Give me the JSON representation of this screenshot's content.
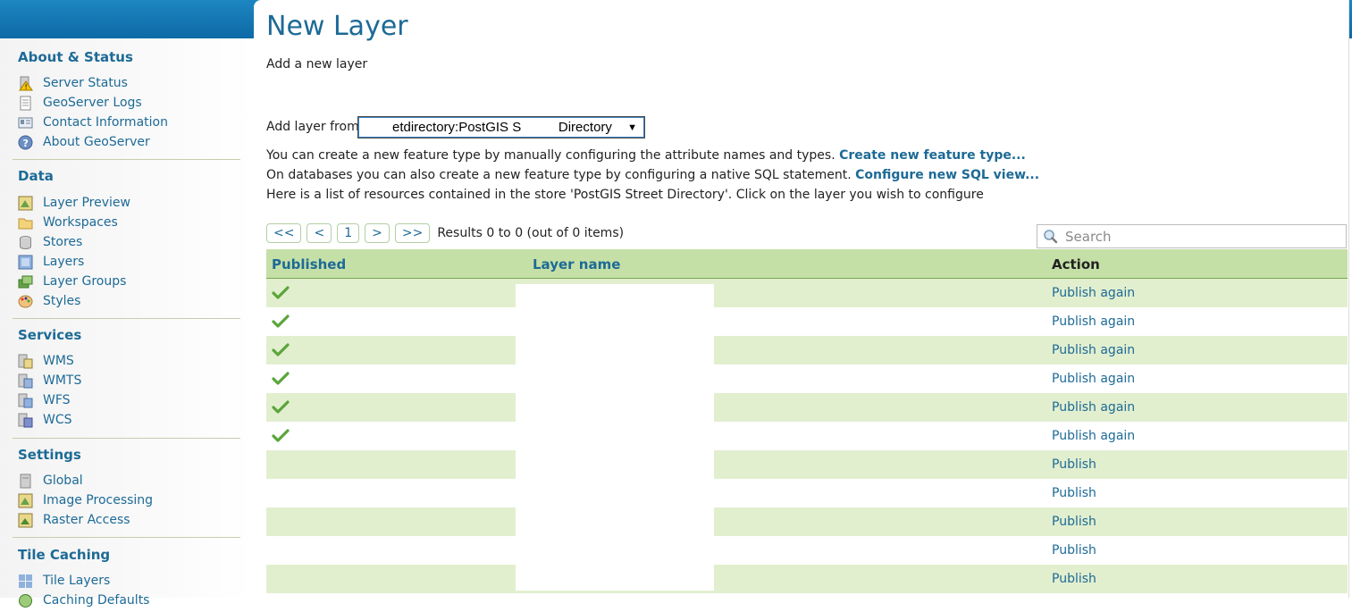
{
  "header": {
    "color": "#1479b8"
  },
  "sidebar": {
    "sections": [
      {
        "title": "About & Status",
        "items": [
          {
            "label": "Server Status",
            "icon": "server-status-icon"
          },
          {
            "label": "GeoServer Logs",
            "icon": "logs-icon"
          },
          {
            "label": "Contact Information",
            "icon": "contact-icon"
          },
          {
            "label": "About GeoServer",
            "icon": "about-icon"
          }
        ]
      },
      {
        "title": "Data",
        "items": [
          {
            "label": "Layer Preview",
            "icon": "layer-preview-icon"
          },
          {
            "label": "Workspaces",
            "icon": "folder-icon"
          },
          {
            "label": "Stores",
            "icon": "database-icon"
          },
          {
            "label": "Layers",
            "icon": "layers-icon"
          },
          {
            "label": "Layer Groups",
            "icon": "layer-groups-icon"
          },
          {
            "label": "Styles",
            "icon": "palette-icon"
          }
        ]
      },
      {
        "title": "Services",
        "items": [
          {
            "label": "WMS",
            "icon": "wms-icon"
          },
          {
            "label": "WMTS",
            "icon": "wmts-icon"
          },
          {
            "label": "WFS",
            "icon": "wfs-icon"
          },
          {
            "label": "WCS",
            "icon": "wcs-icon"
          }
        ]
      },
      {
        "title": "Settings",
        "items": [
          {
            "label": "Global",
            "icon": "global-icon"
          },
          {
            "label": "Image Processing",
            "icon": "image-processing-icon"
          },
          {
            "label": "Raster Access",
            "icon": "raster-access-icon"
          }
        ]
      },
      {
        "title": "Tile Caching",
        "items": [
          {
            "label": "Tile Layers",
            "icon": "tile-layers-icon"
          },
          {
            "label": "Caching Defaults",
            "icon": "caching-defaults-icon"
          }
        ]
      }
    ]
  },
  "main": {
    "title": "New Layer",
    "description": "Add a new layer",
    "add_from_label": "Add layer from",
    "store_select_value": "etdirectory:PostGIS S          Directory",
    "info": {
      "line1_text": "You can create a new feature type by manually configuring the attribute names and types. ",
      "line1_link": "Create new feature type...",
      "line2_text": "On databases you can also create a new feature type by configuring a native SQL statement. ",
      "line2_link": "Configure new SQL view...",
      "line3_text": "Here is a list of resources contained in the store 'PostGIS Street Directory'. Click on the layer you wish to configure"
    },
    "pager": {
      "first": "<<",
      "prev": "<",
      "page": "1",
      "next": ">",
      "last": ">>",
      "results": "Results 0 to 0 (out of 0 items)"
    },
    "search": {
      "placeholder": "Search"
    },
    "table": {
      "headers": {
        "published": "Published",
        "layer_name": "Layer name",
        "action": "Action"
      },
      "rows": [
        {
          "published": true,
          "action": "Publish again"
        },
        {
          "published": true,
          "action": "Publish again"
        },
        {
          "published": true,
          "action": "Publish again"
        },
        {
          "published": true,
          "action": "Publish again"
        },
        {
          "published": true,
          "action": "Publish again"
        },
        {
          "published": true,
          "action": "Publish again"
        },
        {
          "published": false,
          "action": "Publish"
        },
        {
          "published": false,
          "action": "Publish"
        },
        {
          "published": false,
          "action": "Publish"
        },
        {
          "published": false,
          "action": "Publish"
        },
        {
          "published": false,
          "action": "Publish"
        }
      ]
    }
  },
  "colors": {
    "link": "#1d6a96",
    "row_alt": "#e2efcf",
    "header_row": "#c5e0a6",
    "check": "#5aa53a"
  }
}
